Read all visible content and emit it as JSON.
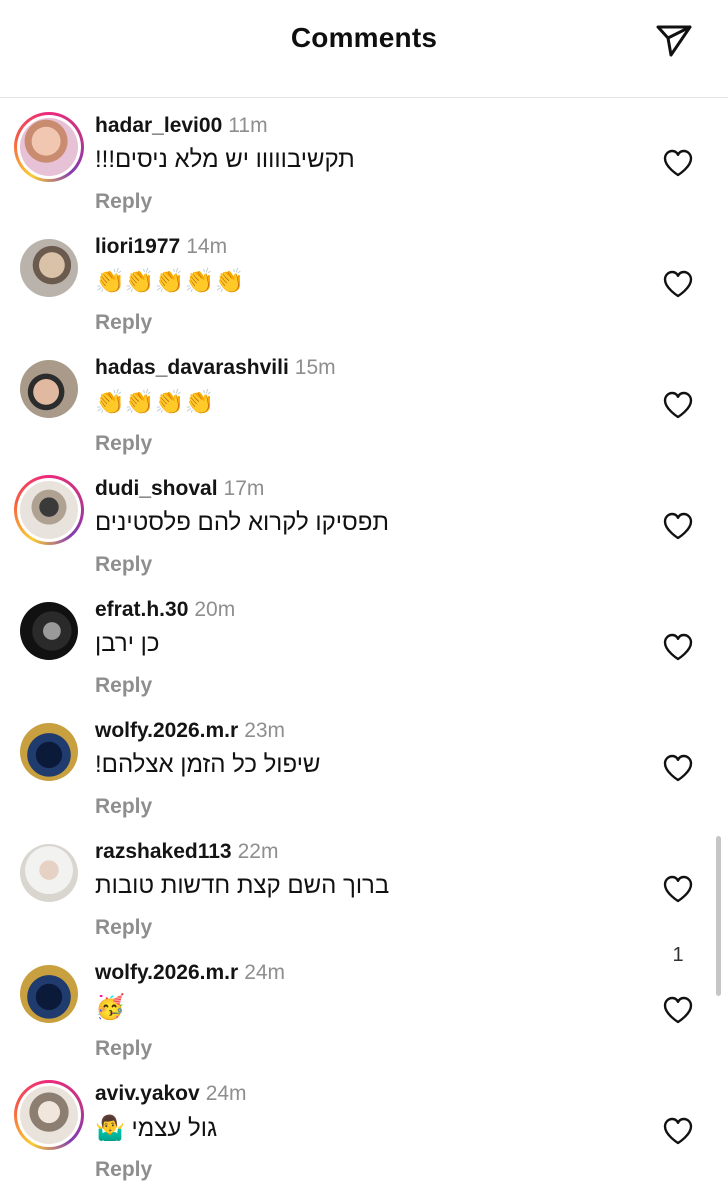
{
  "header": {
    "title": "Comments",
    "share_icon": "paper-plane-icon"
  },
  "comments": [
    {
      "username": "hadar_levi00",
      "time": "11m",
      "text": "תקשיבווווו יש מלא ניסים!!!",
      "reply": "Reply",
      "story_ring": true,
      "like_count": ""
    },
    {
      "username": "liori1977",
      "time": "14m",
      "text": "👏👏👏👏👏",
      "reply": "Reply",
      "story_ring": false,
      "like_count": ""
    },
    {
      "username": "hadas_davarashvili",
      "time": "15m",
      "text": "👏👏👏👏",
      "reply": "Reply",
      "story_ring": false,
      "like_count": ""
    },
    {
      "username": "dudi_shoval",
      "time": "17m",
      "text": "תפסיקו לקרוא להם פלסטינים",
      "reply": "Reply",
      "story_ring": true,
      "like_count": ""
    },
    {
      "username": "efrat.h.30",
      "time": "20m",
      "text": "כן ירבן",
      "reply": "Reply",
      "story_ring": false,
      "like_count": ""
    },
    {
      "username": "wolfy.2026.m.r",
      "time": "23m",
      "text": "שיפול כל הזמן אצלהם!",
      "reply": "Reply",
      "story_ring": false,
      "like_count": ""
    },
    {
      "username": "razshaked113",
      "time": "22m",
      "text": "ברוך השם קצת חדשות טובות",
      "reply": "Reply",
      "story_ring": false,
      "like_count": "1"
    },
    {
      "username": "wolfy.2026.m.r",
      "time": "24m",
      "text": "🥳",
      "reply": "Reply",
      "story_ring": false,
      "like_count": ""
    },
    {
      "username": "aviv.yakov",
      "time": "24m",
      "text": "גול עצמי 🤷‍♂️",
      "reply": "Reply",
      "story_ring": true,
      "like_count": ""
    }
  ],
  "icons": {
    "like": "heart-outline-icon",
    "avatar": "profile-photo"
  },
  "colors": {
    "secondary_text": "#8e8e8e",
    "primary_text": "#141414",
    "story_ring": [
      "#f9ce34",
      "#ee2a7b",
      "#833ab4"
    ]
  }
}
